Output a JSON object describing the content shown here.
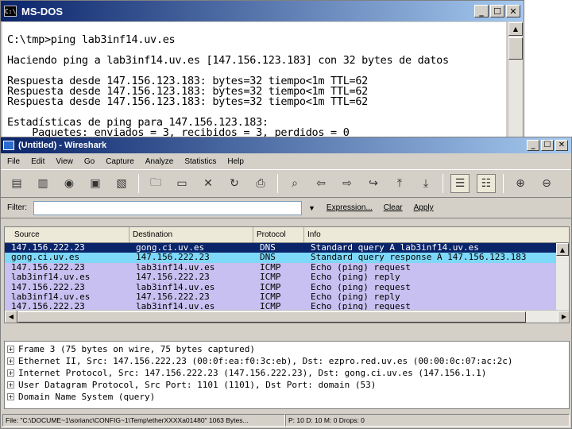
{
  "dos": {
    "title": "MS-DOS",
    "icon_text": "C:\\",
    "lines": [
      "",
      "C:\\tmp>ping lab3inf14.uv.es",
      "",
      "Haciendo ping a lab3inf14.uv.es [147.156.123.183] con 32 bytes de datos",
      "",
      "Respuesta desde 147.156.123.183: bytes=32 tiempo<1m TTL=62",
      "Respuesta desde 147.156.123.183: bytes=32 tiempo<1m TTL=62",
      "Respuesta desde 147.156.123.183: bytes=32 tiempo<1m TTL=62",
      "",
      "Estadísticas de ping para 147.156.123.183:",
      "    Paquetes: enviados = 3, recibidos = 3, perdidos = 0"
    ]
  },
  "window_buttons": {
    "minimize": "_",
    "maximize": "☐",
    "close": "✕"
  },
  "wireshark": {
    "title": "(Untitled) - Wireshark",
    "menu": [
      "File",
      "Edit",
      "View",
      "Go",
      "Capture",
      "Analyze",
      "Statistics",
      "Help"
    ],
    "toolbar_icons": [
      "interfaces-icon",
      "options-icon",
      "start-capture-icon",
      "stop-capture-icon",
      "restart-capture-icon",
      "open-icon",
      "save-icon",
      "close-icon",
      "reload-icon",
      "print-icon",
      "find-icon",
      "back-icon",
      "forward-icon",
      "goto-icon",
      "top-icon",
      "bottom-icon",
      "colorize-icon",
      "autoscroll-icon",
      "zoom-in-icon",
      "zoom-out-icon"
    ],
    "filter": {
      "label": "Filter:",
      "value": "",
      "expression": "Expression...",
      "clear": "Clear",
      "apply": "Apply"
    },
    "columns": [
      "Source",
      "Destination",
      "Protocol",
      "Info"
    ],
    "packets": [
      {
        "src": "147.156.222.23",
        "dst": "gong.ci.uv.es",
        "proto": "DNS",
        "info": "Standard query A lab3inf14.uv.es",
        "bg": "#0a246a",
        "fg": "#ffffff"
      },
      {
        "src": "gong.ci.uv.es",
        "dst": "147.156.222.23",
        "proto": "DNS",
        "info": "Standard query response A 147.156.123.183",
        "bg": "#7ed8f8",
        "fg": "#000000"
      },
      {
        "src": "147.156.222.23",
        "dst": "lab3inf14.uv.es",
        "proto": "ICMP",
        "info": "Echo (ping) request",
        "bg": "#c8c0f0",
        "fg": "#000000"
      },
      {
        "src": "lab3inf14.uv.es",
        "dst": "147.156.222.23",
        "proto": "ICMP",
        "info": "Echo (ping) reply",
        "bg": "#c8c0f0",
        "fg": "#000000"
      },
      {
        "src": "147.156.222.23",
        "dst": "lab3inf14.uv.es",
        "proto": "ICMP",
        "info": "Echo (ping) request",
        "bg": "#c8c0f0",
        "fg": "#000000"
      },
      {
        "src": "lab3inf14.uv.es",
        "dst": "147.156.222.23",
        "proto": "ICMP",
        "info": "Echo (ping) reply",
        "bg": "#c8c0f0",
        "fg": "#000000"
      },
      {
        "src": "147.156.222.23",
        "dst": "lab3inf14.uv.es",
        "proto": "ICMP",
        "info": "Echo (ping) request",
        "bg": "#c8c0f0",
        "fg": "#000000"
      },
      {
        "src": "lab3inf14.uv.es",
        "dst": "147.156.222.23",
        "proto": "ICMP",
        "info": "Echo (ping) reply",
        "bg": "#c8c0f0",
        "fg": "#000000"
      }
    ],
    "details": [
      "Frame 3 (75 bytes on wire, 75 bytes captured)",
      "Ethernet II, Src: 147.156.222.23 (00:0f:ea:f0:3c:eb), Dst: ezpro.red.uv.es (00:00:0c:07:ac:2c)",
      "Internet Protocol, Src: 147.156.222.23 (147.156.222.23), Dst: gong.ci.uv.es (147.156.1.1)",
      "User Datagram Protocol, Src Port: 1101 (1101), Dst Port: domain (53)",
      "Domain Name System (query)"
    ],
    "expander": "+",
    "status": {
      "file": "File: \"C:\\DOCUME~1\\sorianc\\CONFIG~1\\Temp\\etherXXXXa01480\" 1063 Bytes...",
      "counts": "P: 10 D: 10 M: 0 Drops: 0"
    }
  }
}
